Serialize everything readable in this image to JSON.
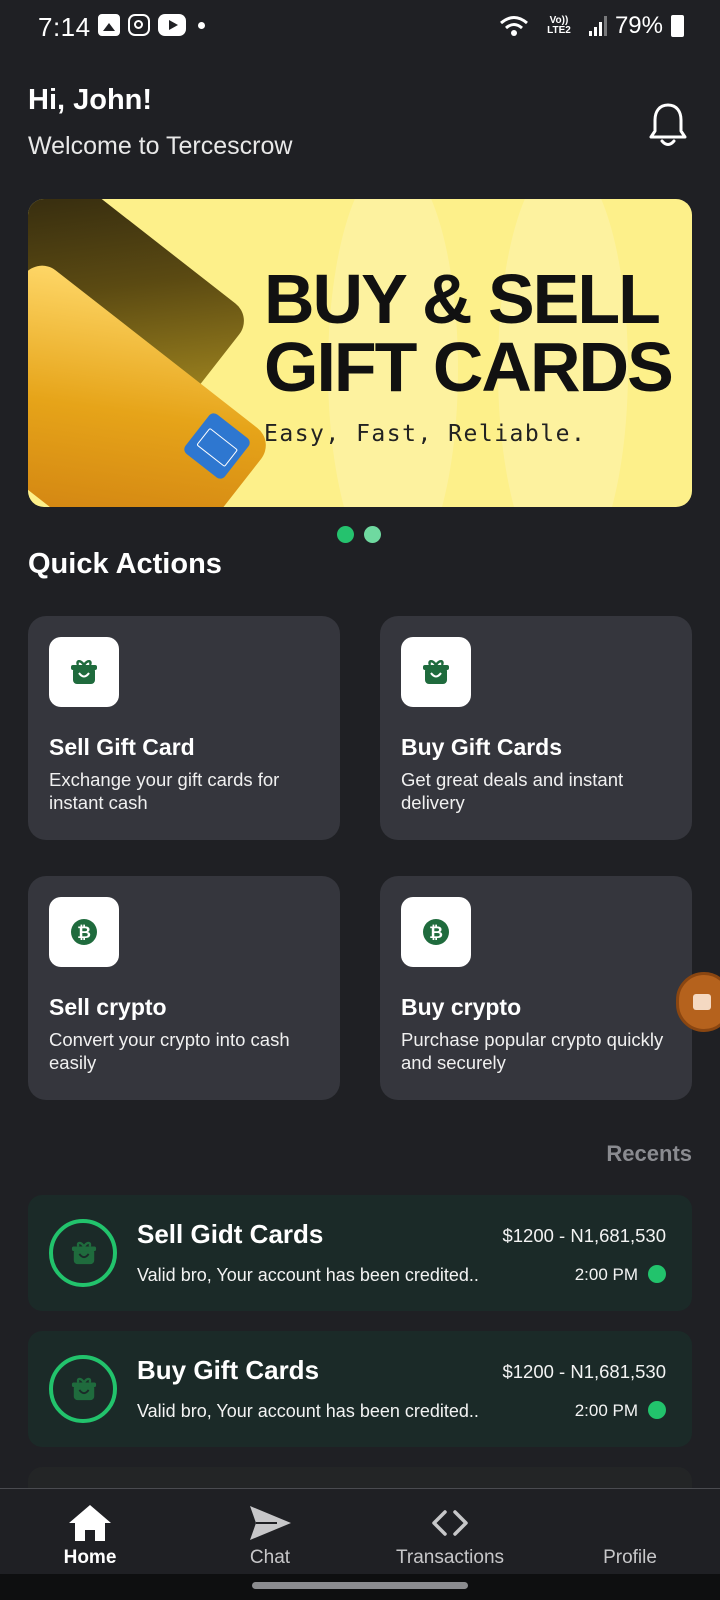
{
  "status_bar": {
    "time": "7:14",
    "battery": "79%",
    "network": "Vo)) LTE2"
  },
  "header": {
    "greeting": "Hi, John!",
    "welcome": "Welcome to Tercescrow"
  },
  "banner": {
    "title_line1": "BUY & SELL",
    "title_line2": "GIFT CARDS",
    "subtitle": "Easy, Fast, Reliable.",
    "page_index": 1,
    "page_count": 2
  },
  "quick_actions": {
    "title": "Quick Actions",
    "items": [
      {
        "title": "Sell Gift Card",
        "desc": "Exchange your gift cards for instant cash",
        "icon": "gift-card-icon"
      },
      {
        "title": "Buy Gift Cards",
        "desc": "Get great deals and instant delivery",
        "icon": "gift-card-icon"
      },
      {
        "title": "Sell crypto",
        "desc": "Convert your crypto into cash easily",
        "icon": "bitcoin-icon"
      },
      {
        "title": "Buy crypto",
        "desc": "Purchase popular crypto quickly and securely",
        "icon": "bitcoin-icon"
      }
    ]
  },
  "recents": {
    "label": "Recents",
    "items": [
      {
        "title": "Sell Gidt Cards",
        "message": "Valid bro, Your account has been credited..",
        "amount": "$1200 - N1,681,530",
        "time": "2:00 PM"
      },
      {
        "title": "Buy Gift Cards",
        "message": "Valid bro, Your account has been credited..",
        "amount": "$1200 - N1,681,530",
        "time": "2:00 PM"
      }
    ]
  },
  "nav": {
    "items": [
      {
        "label": "Home",
        "icon": "home-icon",
        "active": true
      },
      {
        "label": "Chat",
        "icon": "send-icon",
        "active": false
      },
      {
        "label": "Transactions",
        "icon": "code-icon",
        "active": false
      },
      {
        "label": "Profile",
        "icon": "profile-icon",
        "active": false
      }
    ]
  },
  "colors": {
    "background": "#1f2024",
    "card": "#35363d",
    "accent_green": "#22c36c",
    "banner_yellow": "#fdf08a",
    "recent_card": "#1b2a28"
  }
}
